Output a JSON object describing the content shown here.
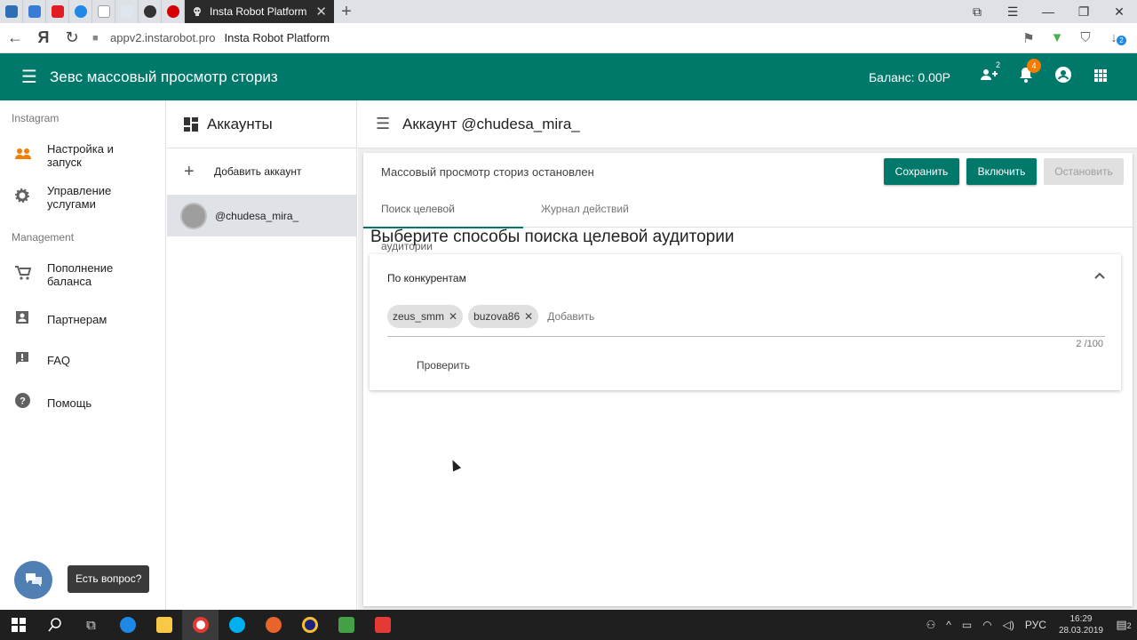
{
  "browser": {
    "tab_title": "Insta Robot Platform",
    "url": "appv2.instarobot.pro",
    "page_title": "Insta Robot Platform",
    "pinned_tab_colors": [
      "#2c6fb5",
      "#3a7bd5",
      "#e31b23",
      "#1e88e5",
      "#9e9e9e",
      "#5c8fd6",
      "#333333",
      "#d50000"
    ],
    "download_badge": "2"
  },
  "header": {
    "title": "Зевс массовый просмотр сториз",
    "balance": "Баланс: 0.00Р",
    "people_badge": "2",
    "notifications_badge": "4",
    "accent_color": "#00796b"
  },
  "sidebar": {
    "section_instagram": "Instagram",
    "section_management": "Management",
    "items": [
      {
        "label": "Настройка и запуск",
        "icon": "people-icon"
      },
      {
        "label": "Управление услугами",
        "icon": "gear-icon"
      },
      {
        "label": "Пополнение баланса",
        "icon": "cart-icon"
      },
      {
        "label": "Партнерам",
        "icon": "contact-card-icon"
      },
      {
        "label": "FAQ",
        "icon": "feedback-icon"
      },
      {
        "label": "Помощь",
        "icon": "help-icon"
      }
    ],
    "chat_tooltip": "Есть вопрос?"
  },
  "accounts": {
    "title": "Аккаунты",
    "add_label": "Добавить аккаунт",
    "items": [
      {
        "name": "@chudesa_mira_"
      }
    ]
  },
  "main": {
    "title": "Аккаунт @chudesa_mira_",
    "status": "Массовый просмотр сториз остановлен",
    "buttons": {
      "save": "Сохранить",
      "enable": "Включить",
      "stop": "Остановить"
    },
    "tabs": [
      "Поиск целевой аудитории",
      "Журнал действий"
    ],
    "section_title": "Выберите способы поиска целевой аудитории",
    "panel": {
      "title": "По конкурентам",
      "chips": [
        "zeus_smm",
        "buzova86"
      ],
      "input_placeholder": "Добавить",
      "counter": "2 /100",
      "check_label": "Проверить"
    }
  },
  "taskbar": {
    "time": "16:29",
    "date": "28.03.2019",
    "language": "РУС",
    "notification_count": "2"
  }
}
